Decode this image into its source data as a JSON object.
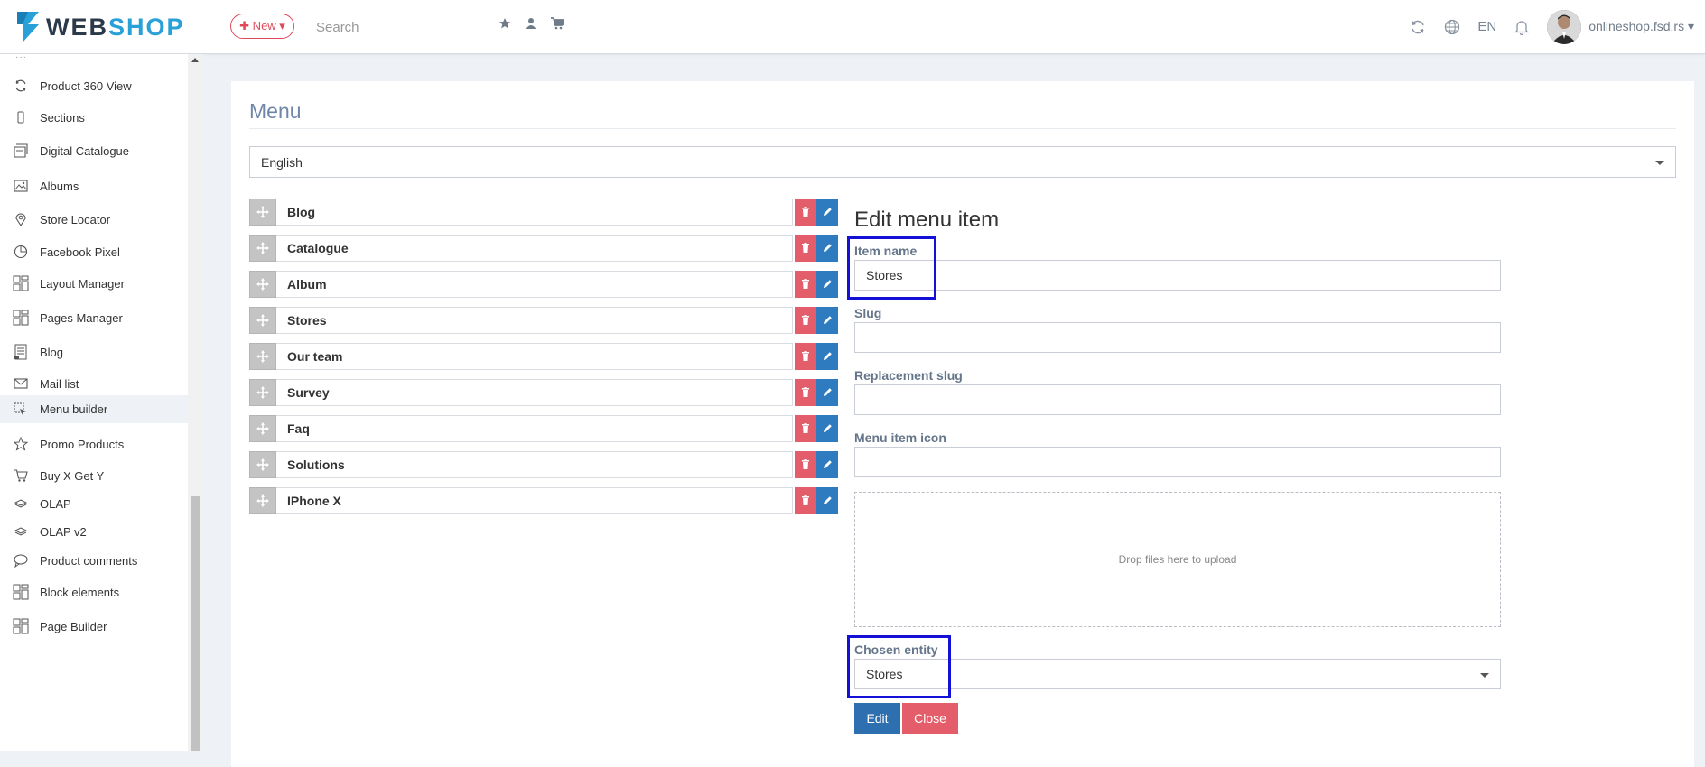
{
  "brand": {
    "logo_web": "WEB",
    "logo_shop": "SHOP",
    "accent": "#2aa0d8"
  },
  "header": {
    "new_button": "✚ New ▾",
    "search_placeholder": "Search",
    "language": "EN",
    "user": "onlineshop.fsd.rs ▾"
  },
  "sidebar": {
    "items": [
      {
        "label": "Product 360 View",
        "icon": "refresh-icon"
      },
      {
        "label": "Sections",
        "icon": "mobile-icon"
      },
      {
        "label": "Digital Catalogue",
        "icon": "book-icon"
      },
      {
        "label": "Albums",
        "icon": "image-icon"
      },
      {
        "label": "Store Locator",
        "icon": "map-icon"
      },
      {
        "label": "Facebook Pixel",
        "icon": "pie-chart-icon"
      },
      {
        "label": "Layout Manager",
        "icon": "layout-icon"
      },
      {
        "label": "Pages Manager",
        "icon": "layout-icon"
      },
      {
        "label": "Blog",
        "icon": "blog-icon"
      },
      {
        "label": "Mail list",
        "icon": "envelope-icon"
      },
      {
        "label": "Menu builder",
        "icon": "cursor-icon",
        "active": true
      },
      {
        "label": "Promo Products",
        "icon": "star-icon"
      },
      {
        "label": "Buy X Get Y",
        "icon": "cart-icon"
      },
      {
        "label": "OLAP",
        "icon": "layers-icon"
      },
      {
        "label": "OLAP v2",
        "icon": "layers-icon"
      },
      {
        "label": "Product comments",
        "icon": "comment-icon"
      },
      {
        "label": "Block elements",
        "icon": "layout-icon"
      },
      {
        "label": "Page Builder",
        "icon": "layout-icon"
      }
    ]
  },
  "main": {
    "title": "Menu",
    "language_select": "English",
    "menu_items": [
      "Blog",
      "Catalogue",
      "Album",
      "Stores",
      "Our team",
      "Survey",
      "Faq",
      "Solutions",
      "IPhone X"
    ],
    "edit_form": {
      "title": "Edit menu item",
      "item_name_label": "Item name",
      "item_name_value": "Stores",
      "slug_label": "Slug",
      "slug_value": "",
      "replacement_slug_label": "Replacement slug",
      "replacement_slug_value": "",
      "icon_label": "Menu item icon",
      "icon_value": "",
      "dropzone_text": "Drop files here to upload",
      "chosen_entity_label": "Chosen entity",
      "chosen_entity_value": "Stores",
      "edit_button": "Edit",
      "close_button": "Close"
    }
  },
  "colors": {
    "delete": "#e35d6a",
    "edit": "#2e7cbf",
    "highlight": "#1410d8",
    "title": "#6f86a8"
  }
}
